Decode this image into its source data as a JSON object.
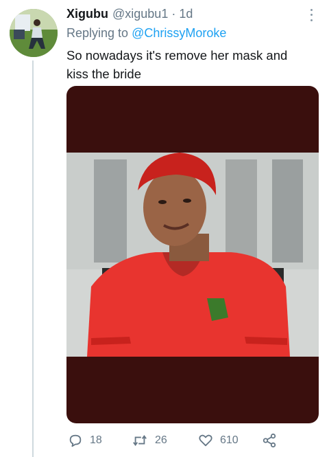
{
  "tweet": {
    "author_name": "Xigubu",
    "author_handle": "@xigubu1",
    "separator": "·",
    "time": "1d",
    "reply_prefix": "Replying to",
    "reply_mention": "@ChrissyMoroke",
    "text": "So nowadays it's remove her mask and kiss the bride"
  },
  "actions": {
    "reply_count": "18",
    "retweet_count": "26",
    "like_count": "610"
  },
  "icons": {
    "more": "more-vertical-icon",
    "reply": "reply-icon",
    "retweet": "retweet-icon",
    "like": "heart-icon",
    "share": "share-icon"
  },
  "colors": {
    "link": "#1da1f2",
    "secondary_text": "#657786",
    "media_background": "#3a0f0d",
    "shirt": "#e8342f"
  }
}
